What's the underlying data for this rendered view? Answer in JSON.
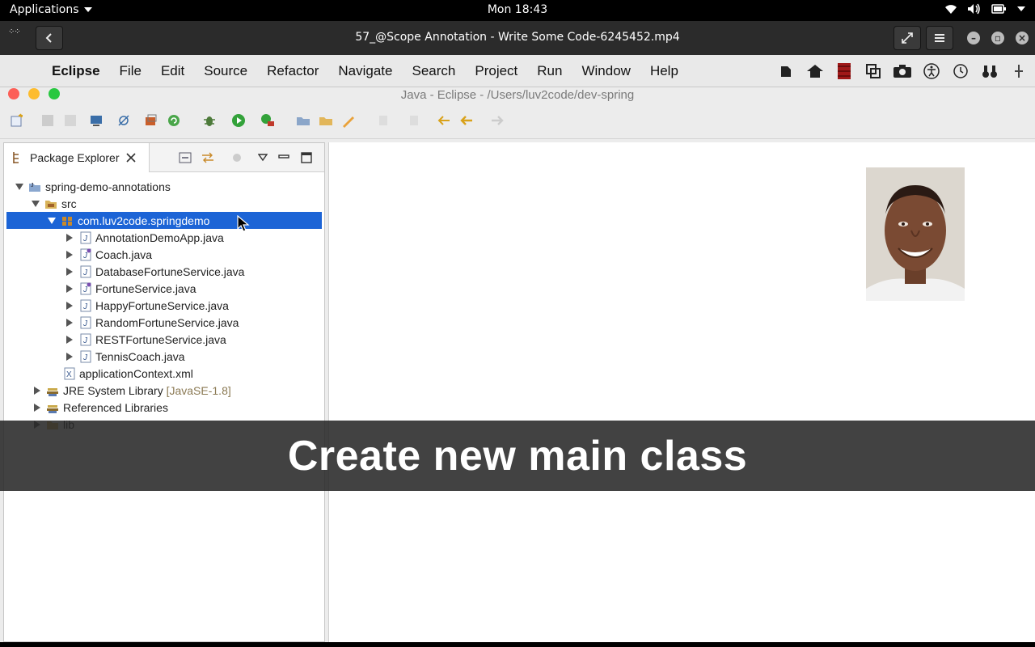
{
  "gnome": {
    "applications_label": "Applications",
    "clock": "Mon 18:43",
    "tray_icons": [
      "wifi-icon",
      "volume-icon",
      "battery-icon",
      "chevron-down-icon"
    ]
  },
  "player": {
    "title": "57_@Scope Annotation - Write Some Code-6245452.mp4",
    "buttons": [
      "back-icon",
      "fullscreen-icon",
      "menu-icon",
      "minimize-icon",
      "maximize-icon",
      "close-icon"
    ]
  },
  "mac_menu": {
    "app_name": "Eclipse",
    "items": [
      "File",
      "Edit",
      "Source",
      "Refactor",
      "Navigate",
      "Search",
      "Project",
      "Run",
      "Window",
      "Help"
    ]
  },
  "eclipse": {
    "window_title": "Java - Eclipse - /Users/luv2code/dev-spring"
  },
  "package_explorer": {
    "tab_label": "Package Explorer",
    "tree": [
      {
        "label": "spring-demo-annotations",
        "decoration": "",
        "icon": "project-folder-icon",
        "expanded": true
      },
      {
        "label": "src",
        "decoration": "",
        "icon": "source-folder-icon",
        "expanded": true
      },
      {
        "label": "com.luv2code.springdemo",
        "decoration": "",
        "icon": "package-icon",
        "expanded": true,
        "selected": true
      },
      {
        "label": "AnnotationDemoApp.java",
        "decoration": "",
        "icon": "java-class-icon",
        "expanded": false
      },
      {
        "label": "Coach.java",
        "decoration": "",
        "icon": "java-interface-icon",
        "expanded": false
      },
      {
        "label": "DatabaseFortuneService.java",
        "decoration": "",
        "icon": "java-class-icon",
        "expanded": false
      },
      {
        "label": "FortuneService.java",
        "decoration": "",
        "icon": "java-interface-icon",
        "expanded": false
      },
      {
        "label": "HappyFortuneService.java",
        "decoration": "",
        "icon": "java-class-icon",
        "expanded": false
      },
      {
        "label": "RandomFortuneService.java",
        "decoration": "",
        "icon": "java-class-icon",
        "expanded": false
      },
      {
        "label": "RESTFortuneService.java",
        "decoration": "",
        "icon": "java-class-icon",
        "expanded": false
      },
      {
        "label": "TennisCoach.java",
        "decoration": "",
        "icon": "java-class-icon",
        "expanded": false
      },
      {
        "label": "applicationContext.xml",
        "decoration": "",
        "icon": "xml-file-icon",
        "expanded": null
      },
      {
        "label": "JRE System Library",
        "decoration": "[JavaSE-1.8]",
        "icon": "library-icon",
        "expanded": false
      },
      {
        "label": "Referenced Libraries",
        "decoration": "",
        "icon": "library-icon",
        "expanded": false
      },
      {
        "label": "lib",
        "decoration": "",
        "icon": "folder-icon",
        "expanded": false
      }
    ]
  },
  "caption": "Create new main class",
  "colors": {
    "selection": "#1c64d6",
    "caption_bg": "#282828",
    "menubar": "#e9e9e9"
  }
}
